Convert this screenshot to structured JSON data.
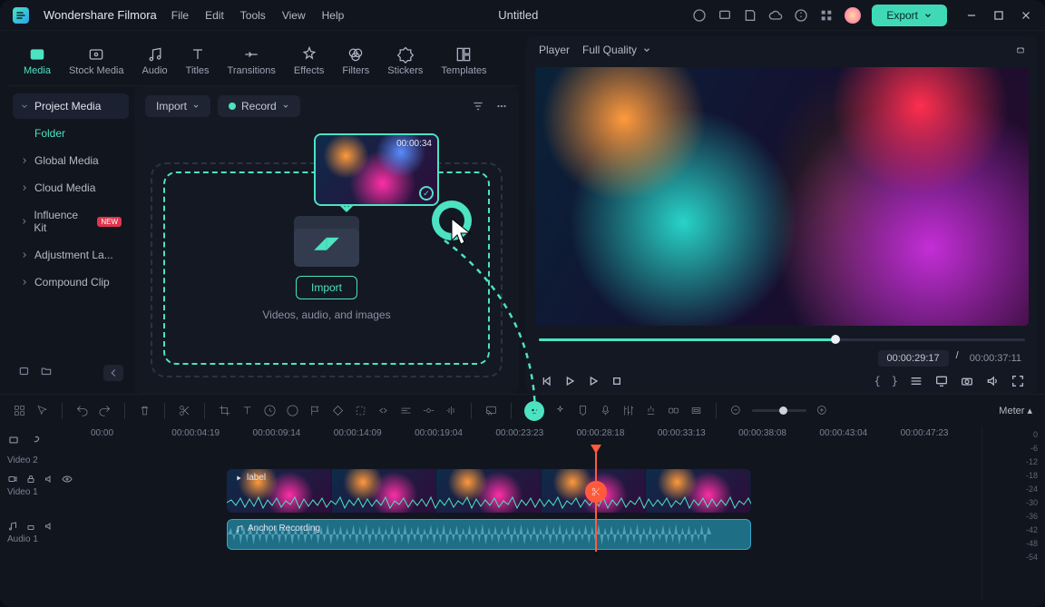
{
  "app_name": "Wondershare Filmora",
  "menu": [
    "File",
    "Edit",
    "Tools",
    "View",
    "Help"
  ],
  "document_title": "Untitled",
  "export_label": "Export",
  "toolbar": [
    {
      "label": "Media",
      "active": true
    },
    {
      "label": "Stock Media"
    },
    {
      "label": "Audio"
    },
    {
      "label": "Titles"
    },
    {
      "label": "Transitions"
    },
    {
      "label": "Effects"
    },
    {
      "label": "Filters"
    },
    {
      "label": "Stickers"
    },
    {
      "label": "Templates"
    }
  ],
  "sidebar": {
    "project_media": "Project Media",
    "folder": "Folder",
    "items": [
      {
        "label": "Global Media"
      },
      {
        "label": "Cloud Media"
      },
      {
        "label": "Influence Kit",
        "badge": "NEW"
      },
      {
        "label": "Adjustment La..."
      },
      {
        "label": "Compound Clip"
      }
    ]
  },
  "media_panel": {
    "import": "Import",
    "record": "Record",
    "import_btn": "Import",
    "hint": "Videos, audio, and images",
    "clip_time": "00:00:34"
  },
  "player": {
    "title": "Player",
    "quality": "Full Quality",
    "current": "00:00:29:17",
    "duration": "00:00:37:11",
    "progress_pct": 61
  },
  "ruler": [
    "00:00",
    "00:00:04:19",
    "00:00:09:14",
    "00:00:14:09",
    "00:00:19:04",
    "00:00:23:23",
    "00:00:28:18",
    "00:00:33:13",
    "00:00:38:08",
    "00:00:43:04",
    "00:00:47:23"
  ],
  "tracks": {
    "video2": "Video 2",
    "video1": "Video 1",
    "audio1": "Audio 1",
    "clip_label": "label",
    "audio_label": "Anchor Recording"
  },
  "meter": {
    "label": "Meter",
    "scale": [
      "0",
      "-6",
      "-12",
      "-18",
      "-24",
      "-30",
      "-36",
      "-42",
      "-48",
      "-54"
    ]
  }
}
